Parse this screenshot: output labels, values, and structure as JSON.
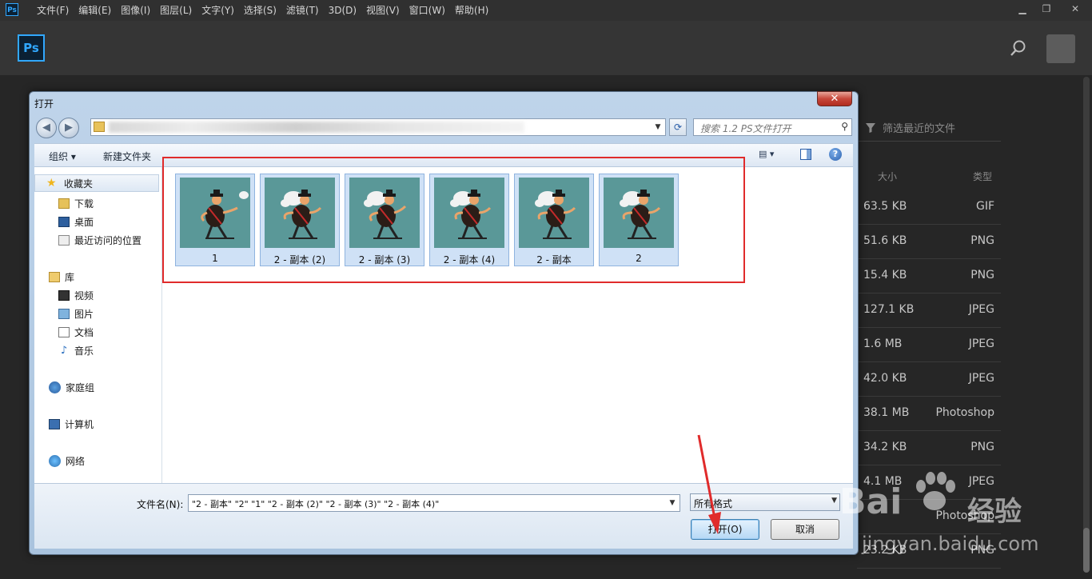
{
  "menubar": {
    "logo": "Ps",
    "items": [
      "文件(F)",
      "编辑(E)",
      "图像(I)",
      "图层(L)",
      "文字(Y)",
      "选择(S)",
      "滤镜(T)",
      "3D(D)",
      "视图(V)",
      "窗口(W)",
      "帮助(H)"
    ]
  },
  "header": {
    "logo": "Ps"
  },
  "background": {
    "filter_placeholder": "筛选最近的文件",
    "col_size": "大小",
    "col_type": "类型",
    "rows": [
      {
        "size": "63.5 KB",
        "type": "GIF"
      },
      {
        "size": "51.6 KB",
        "type": "PNG"
      },
      {
        "size": "15.4 KB",
        "type": "PNG"
      },
      {
        "size": "127.1 KB",
        "type": "JPEG"
      },
      {
        "size": "1.6 MB",
        "type": "JPEG"
      },
      {
        "size": "42.0 KB",
        "type": "JPEG"
      },
      {
        "size": "38.1 MB",
        "type": "Photoshop"
      },
      {
        "size": "34.2 KB",
        "type": "PNG"
      },
      {
        "size": "4.1 MB",
        "type": "JPEG"
      },
      {
        "size": "",
        "type": "Photoshop"
      },
      {
        "size": "23.2 KB",
        "type": "PNG"
      }
    ]
  },
  "dialog": {
    "title": "打开",
    "close": "✕",
    "search_placeholder": "搜索 1.2 PS文件打开",
    "toolbar": {
      "organize": "组织 ▾",
      "new_folder": "新建文件夹"
    },
    "nav": {
      "favorites": "收藏夹",
      "downloads": "下载",
      "desktop": "桌面",
      "recent": "最近访问的位置",
      "libraries": "库",
      "videos": "视频",
      "pictures": "图片",
      "documents": "文档",
      "music": "音乐",
      "homegroup": "家庭组",
      "computer": "计算机",
      "network": "网络"
    },
    "files": [
      {
        "name": "1"
      },
      {
        "name": "2 - 副本 (2)"
      },
      {
        "name": "2 - 副本 (3)"
      },
      {
        "name": "2 - 副本 (4)"
      },
      {
        "name": "2 - 副本"
      },
      {
        "name": "2"
      }
    ],
    "filename_label": "文件名(N):",
    "filename_value": "\"2 - 副本\" \"2\" \"1\" \"2 - 副本 (2)\" \"2 - 副本 (3)\" \"2 - 副本 (4)\"",
    "filetype": "所有格式",
    "open_button": "打开(O)",
    "cancel_button": "取消"
  },
  "watermark": {
    "brand": "Bai",
    "suffix": "经验",
    "url": "jingyan.baidu.com"
  }
}
